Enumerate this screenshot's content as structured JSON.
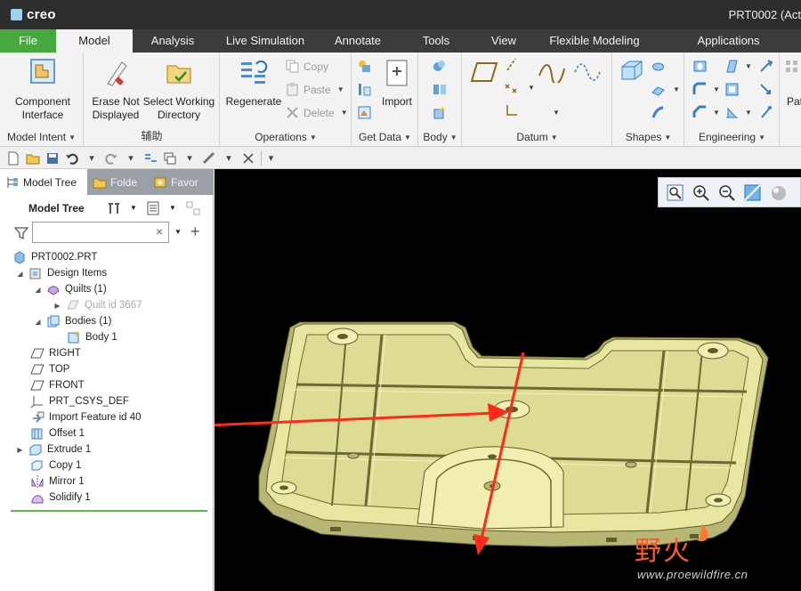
{
  "app": {
    "logo": "creo",
    "window_title": "PRT0002 (Act"
  },
  "tabs": [
    "File",
    "Model",
    "Analysis",
    "Live Simulation",
    "Annotate",
    "Tools",
    "View",
    "Flexible Modeling",
    "Applications"
  ],
  "ribbon": {
    "model_intent": {
      "label": "Model Intent",
      "btn_component": "Component\nInterface"
    },
    "auxiliary": {
      "label": "辅助",
      "btn_erase": "Erase Not\nDisplayed",
      "btn_workdir": "Select Working\nDirectory"
    },
    "operations": {
      "label": "Operations",
      "btn_regenerate": "Regenerate",
      "copy": "Copy",
      "paste": "Paste",
      "delete": "Delete"
    },
    "get_data": {
      "label": "Get Data",
      "btn_import": "Import"
    },
    "body": {
      "label": "Body"
    },
    "datum": {
      "label": "Datum"
    },
    "shapes": {
      "label": "Shapes"
    },
    "engineering": {
      "label": "Engineering"
    },
    "patterns": {
      "label": "Pat"
    }
  },
  "panel": {
    "tabs": [
      "Model Tree",
      "Folde",
      "Favor"
    ],
    "title": "Model Tree",
    "search_placeholder": ""
  },
  "tree": {
    "root": "PRT0002.PRT",
    "design_items": "Design Items",
    "quilts": "Quilts (1)",
    "quilt_id": "Quilt id 3667",
    "bodies": "Bodies (1)",
    "body1": "Body 1",
    "right": "RIGHT",
    "top": "TOP",
    "front": "FRONT",
    "csys": "PRT_CSYS_DEF",
    "import_feature": "Import Feature id 40",
    "offset": "Offset 1",
    "extrude": "Extrude 1",
    "copy": "Copy 1",
    "mirror": "Mirror 1",
    "solidify": "Solidify 1"
  },
  "watermark": {
    "logo_text": "野火",
    "url": "www.proewildfire.cn"
  },
  "colors": {
    "file_tab": "#47a83f",
    "part": "#e8e7a2",
    "arrow": "#ff2a1a",
    "viewport": "#000000"
  }
}
